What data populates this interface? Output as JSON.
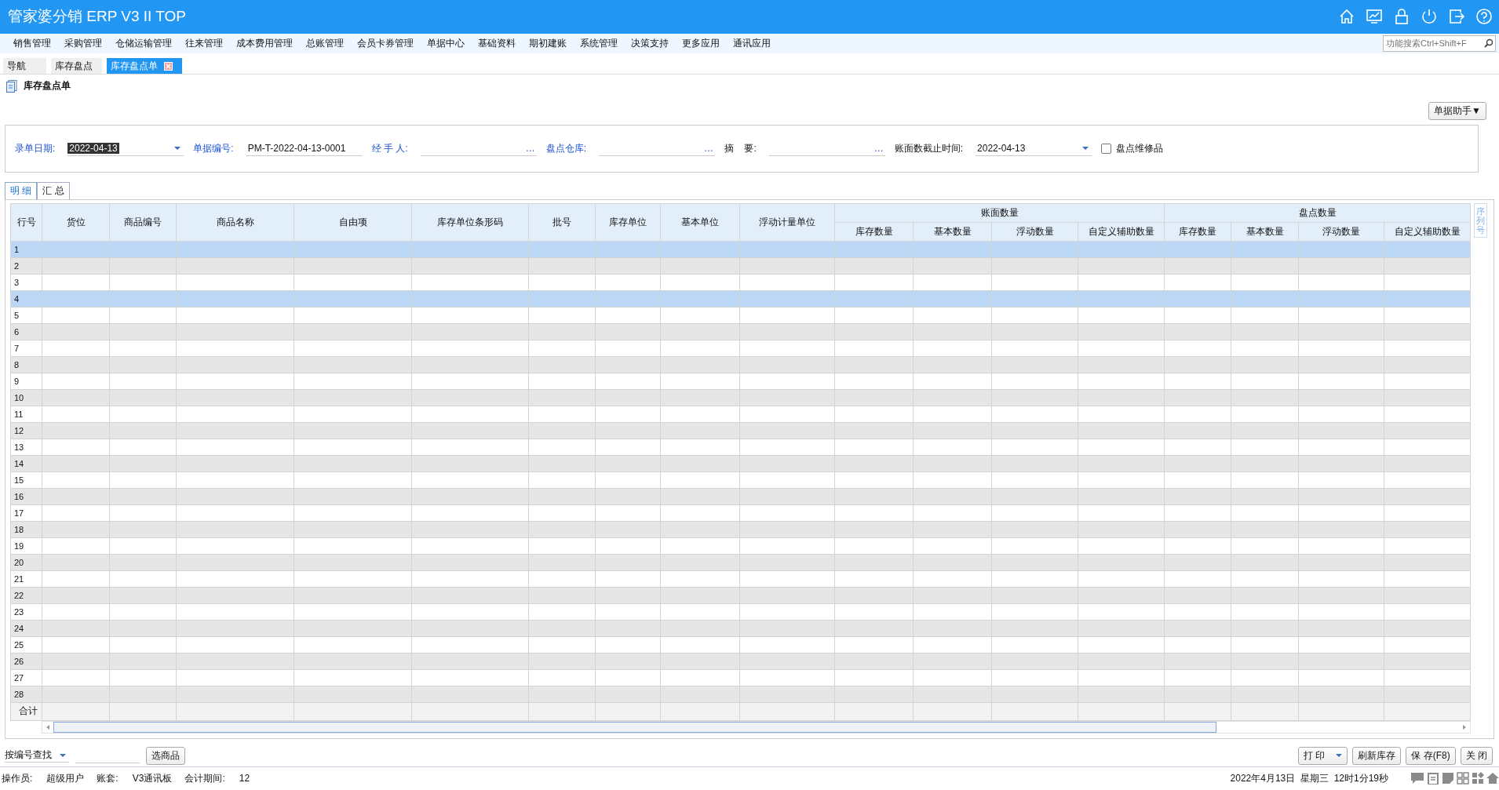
{
  "app_title": "管家婆分销 ERP V3 II TOP",
  "menu": [
    "销售管理",
    "采购管理",
    "仓储运输管理",
    "往来管理",
    "成本费用管理",
    "总账管理",
    "会员卡券管理",
    "单据中心",
    "基础资料",
    "期初建账",
    "系统管理",
    "决策支持",
    "更多应用",
    "通讯应用"
  ],
  "search": {
    "placeholder": "功能搜索Ctrl+Shift+F"
  },
  "tabs": [
    {
      "label": "导航",
      "selected": false,
      "closable": false
    },
    {
      "label": "库存盘点",
      "selected": false,
      "closable": false
    },
    {
      "label": "库存盘点单",
      "selected": true,
      "closable": true
    }
  ],
  "page_title": "库存盘点单",
  "helper_button": "单据助手▼",
  "form": {
    "fields": [
      {
        "label": "录单日期:",
        "value": "2022-04-13",
        "kind": "date",
        "emphasized": true,
        "value_selected": true
      },
      {
        "label": "单据编号:",
        "value": "PM-T-2022-04-13-0001",
        "kind": "text",
        "emphasized": true,
        "value_selected": false
      },
      {
        "label": "经 手 人:",
        "button": "…",
        "kind": "lookup",
        "emphasized": true
      },
      {
        "label": "盘点仓库:",
        "button": "…",
        "kind": "lookup",
        "emphasized": true
      },
      {
        "label": "摘    要:",
        "button": "…",
        "kind": "lookup",
        "emphasized": false
      },
      {
        "label": "账面数截止时间:",
        "value": "2022-04-13",
        "kind": "date",
        "emphasized": false,
        "value_selected": false
      }
    ],
    "checkbox": {
      "label": "盘点维修品",
      "checked": false
    }
  },
  "detail_tabs": [
    {
      "label": "明 细",
      "selected": true
    },
    {
      "label": "汇 总",
      "selected": false
    }
  ],
  "table": {
    "columns": [
      {
        "label": "行号"
      },
      {
        "label": "货位"
      },
      {
        "label": "商品编号"
      },
      {
        "label": "商品名称"
      },
      {
        "label": "自由项"
      },
      {
        "label": "库存单位条形码"
      },
      {
        "label": "批号"
      },
      {
        "label": "库存单位"
      },
      {
        "label": "基本单位"
      },
      {
        "label": "浮动计量单位"
      },
      {
        "label": "账面数量",
        "children": [
          "库存数量",
          "基本数量",
          "浮动数量",
          "自定义辅助数量"
        ]
      },
      {
        "label": "盘点数量",
        "children": [
          "库存数量",
          "基本数量",
          "浮动数量",
          "自定义辅助数量"
        ]
      }
    ],
    "side_label": "序列号",
    "rows": [
      {
        "number": "1",
        "selected": true
      },
      {
        "number": "2",
        "selected": false
      },
      {
        "number": "3",
        "selected": false
      },
      {
        "number": "4",
        "selected": true
      },
      {
        "number": "5",
        "selected": false
      },
      {
        "number": "6",
        "selected": false
      },
      {
        "number": "7",
        "selected": false
      },
      {
        "number": "8",
        "selected": false
      },
      {
        "number": "9",
        "selected": false
      },
      {
        "number": "10",
        "selected": false
      },
      {
        "number": "11",
        "selected": false
      },
      {
        "number": "12",
        "selected": false
      },
      {
        "number": "13",
        "selected": false
      },
      {
        "number": "14",
        "selected": false
      },
      {
        "number": "15",
        "selected": false
      },
      {
        "number": "16",
        "selected": false
      },
      {
        "number": "17",
        "selected": false
      },
      {
        "number": "18",
        "selected": false
      },
      {
        "number": "19",
        "selected": false
      },
      {
        "number": "20",
        "selected": false
      },
      {
        "number": "21",
        "selected": false
      },
      {
        "number": "22",
        "selected": false
      },
      {
        "number": "23",
        "selected": false
      },
      {
        "number": "24",
        "selected": false
      },
      {
        "number": "25",
        "selected": false
      },
      {
        "number": "26",
        "selected": false
      },
      {
        "number": "27",
        "selected": false
      },
      {
        "number": "28",
        "selected": false
      }
    ],
    "total_label": "合计"
  },
  "find_mode": "按编号查找",
  "pick_button": "选商品",
  "actions": [
    {
      "label": "打 印",
      "kind": "dropdown"
    },
    {
      "label": "刷新库存",
      "kind": "plain"
    },
    {
      "label": "保 存(F8)",
      "kind": "plain"
    },
    {
      "label": "关 闭",
      "kind": "plain"
    }
  ],
  "status": {
    "items": [
      {
        "label": "操作员:",
        "value": "超级用户"
      },
      {
        "label": "账套:",
        "value": "V3通讯板"
      },
      {
        "label": "会计期间:",
        "value": "12"
      }
    ],
    "datetime": "2022年4月13日  星期三  12时1分19秒"
  }
}
